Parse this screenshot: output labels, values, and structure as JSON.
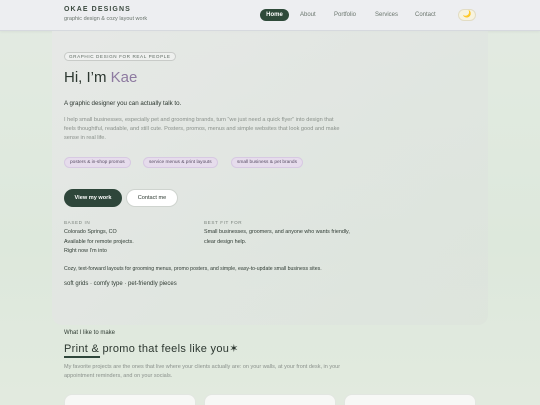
{
  "header": {
    "brand_title": "OKAE DESIGNS",
    "brand_subtitle": "graphic design & cozy layout work",
    "nav": [
      "Home",
      "About",
      "Portfolio",
      "Services",
      "Contact"
    ],
    "active_nav": "Home",
    "theme_icon": "moon-icon",
    "theme_glyph": "🌙"
  },
  "hero": {
    "kicker": "GRAPHIC DESIGN FOR REAL PEOPLE",
    "title_prefix": "Hi, I’m ",
    "title_name": "Kae",
    "lead": "A graphic designer you can actually talk to.",
    "description": "I help small businesses, especially pet and grooming brands, turn “we just need a quick flyer” into design that feels thoughtful, readable, and still cute. Posters, promos, menus and simple websites that look good and make sense in real life.",
    "pills": [
      "posters & in-shop promos",
      "service menus & print layouts",
      "small business & pet brands"
    ],
    "primary_button": "View my work",
    "secondary_button": "Contact me",
    "based_label": "BASED IN",
    "based_lines": [
      "Colorado Springs, CO",
      "Available for remote projects.",
      "Right now I’m into"
    ],
    "fit_label": "BEST FIT FOR",
    "fit_text": "Small businesses, groomers, and anyone who wants friendly, clear design help.",
    "summary": "Cozy, text-forward layouts for grooming menus, promo posters, and simple, easy-to-update small business sites.",
    "tags": "soft grids · comfy type · pet-friendly pieces"
  },
  "section": {
    "eyebrow": "What I like to make",
    "title": "Print & promo that feels like you✶",
    "description": "My favorite projects are the ones that live where your clients actually are: on your walls, at your front desk, in your appointment reminders, and on your socials."
  },
  "colors": {
    "accent": "#2e463a",
    "name_highlight": "#8d7aa0",
    "pill_bg": "#e6dcec"
  }
}
